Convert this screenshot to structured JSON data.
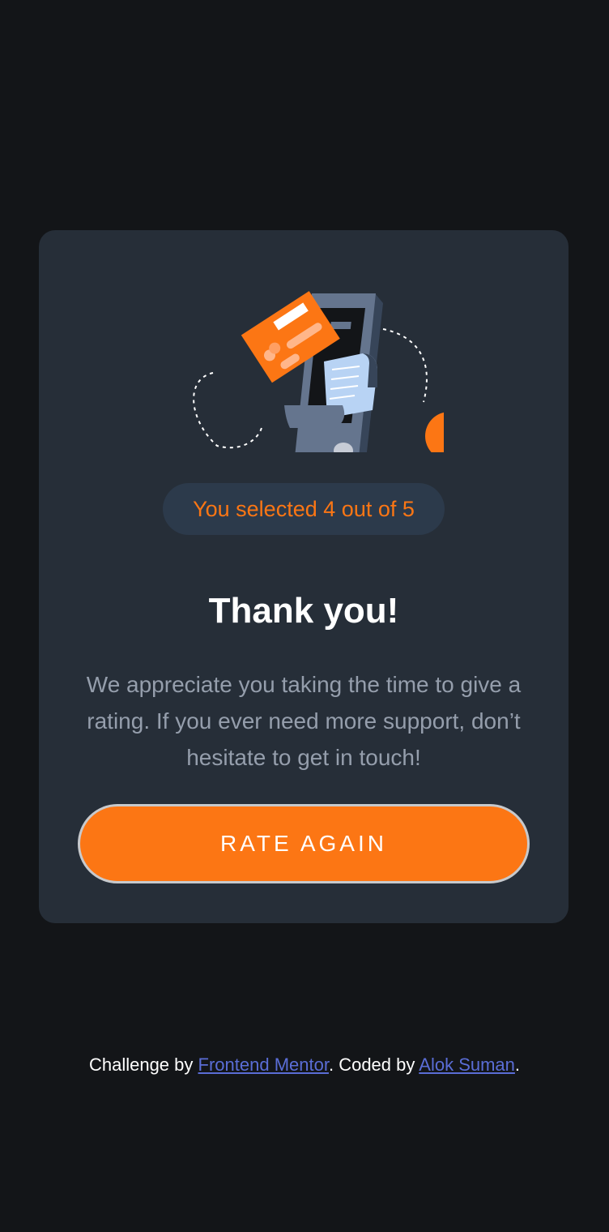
{
  "result": {
    "badge_prefix": "You selected",
    "selected_rating": "4",
    "badge_middle": "out of",
    "max_rating": "5"
  },
  "thank_you": {
    "title": "Thank you!",
    "message": "We appreciate you taking the time to give a rating. If you ever need more support, don’t hesitate to get in touch!"
  },
  "actions": {
    "rate_again_label": "RATE AGAIN"
  },
  "attribution": {
    "challenge_prefix": "Challenge by",
    "challenge_link": "Frontend Mentor",
    "coded_prefix": ". Coded by",
    "coder_link": "Alok Suman",
    "suffix": "."
  },
  "illustration": {
    "icon": "payment-phone-card-illustration"
  },
  "colors": {
    "background": "#131518",
    "card": "#262e38",
    "accent": "#fc7614",
    "badge_bg": "#2c3a4b",
    "text_muted": "#959eac",
    "link": "#5a6dd6"
  }
}
